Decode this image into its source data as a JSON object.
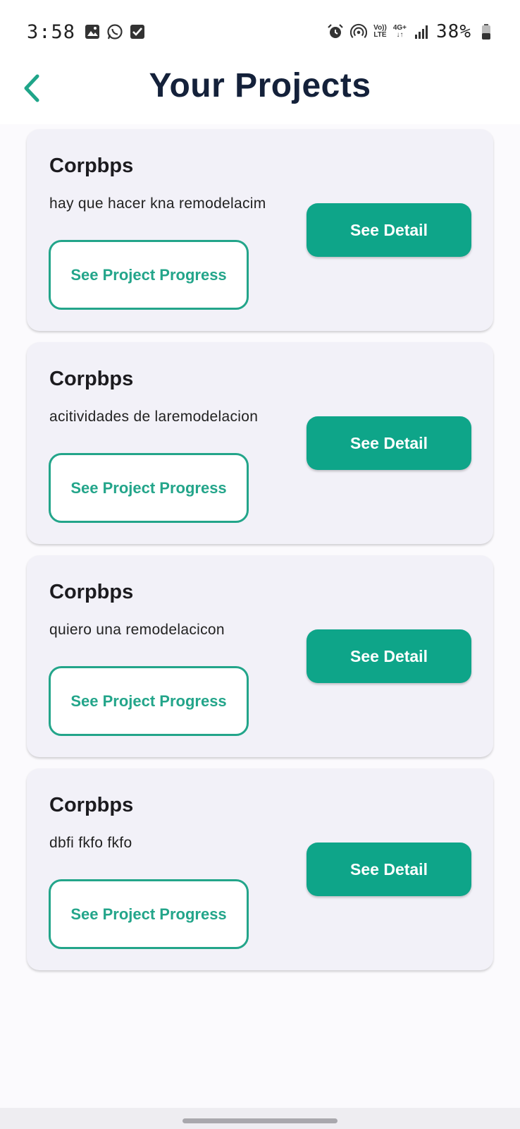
{
  "status_bar": {
    "time": "3:58",
    "battery": "38%",
    "network_volte": "Vo))\nLTE",
    "network_4g": "4G+",
    "icons_left": [
      "gallery-icon",
      "whatsapp-icon",
      "checkbox-icon"
    ],
    "icons_right": [
      "alarm-icon",
      "hotspot-icon",
      "volte-icon",
      "4g-icon",
      "signal-icon",
      "battery-icon"
    ]
  },
  "app_bar": {
    "title": "Your Projects",
    "back_icon": "chevron-left-icon"
  },
  "colors": {
    "accent": "#0ea589",
    "outline": "#23a58a",
    "title": "#14213a",
    "card_bg": "#f2f1f8"
  },
  "projects": [
    {
      "name": "Corpbps",
      "description": "hay que hacer kna remodelacim",
      "progress_label": "See Project Progress",
      "detail_label": "See Detail"
    },
    {
      "name": "Corpbps",
      "description": "acitividades de laremodelacion",
      "progress_label": "See Project Progress",
      "detail_label": "See Detail"
    },
    {
      "name": "Corpbps",
      "description": "quiero una remodelacicon",
      "progress_label": "See Project Progress",
      "detail_label": "See Detail"
    },
    {
      "name": "Corpbps",
      "description": "dbfi fkfo fkfo",
      "progress_label": "See Project Progress",
      "detail_label": "See Detail"
    }
  ]
}
